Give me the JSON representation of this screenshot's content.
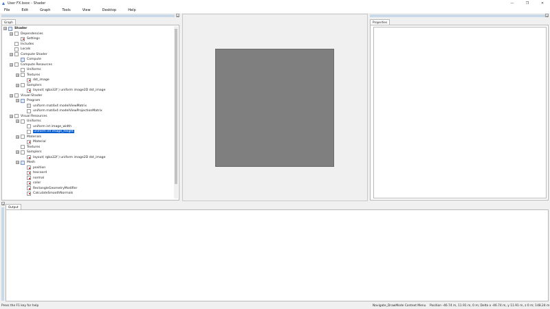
{
  "window": {
    "title": "User FX.bxoc - Shader",
    "min_glyph": "—",
    "max_glyph": "❐",
    "close_glyph": "✕"
  },
  "menu": [
    "File",
    "Edit",
    "Graph",
    "Tools",
    "View",
    "Desktop",
    "Help"
  ],
  "panels": {
    "graph_tab": "Graph",
    "properties_tab": "Properties",
    "output_tab": "Output",
    "close_glyph": "×"
  },
  "tree": [
    {
      "label": "Shader",
      "depth": 0,
      "toggle": "⊟",
      "icon": "blue",
      "bold": true
    },
    {
      "label": "Dependencies",
      "depth": 1,
      "toggle": "⊟",
      "icon": "plain"
    },
    {
      "label": "Settings",
      "depth": 2,
      "toggle": "",
      "icon": "red"
    },
    {
      "label": "Includes",
      "depth": 1,
      "toggle": "",
      "icon": "plain"
    },
    {
      "label": "Locals",
      "depth": 1,
      "toggle": "",
      "icon": "plain"
    },
    {
      "label": "Compute Shader",
      "depth": 1,
      "toggle": "⊟",
      "icon": "plain"
    },
    {
      "label": "Compute",
      "depth": 2,
      "toggle": "",
      "icon": "blue"
    },
    {
      "label": "Compute Resources",
      "depth": 1,
      "toggle": "⊟",
      "icon": "plain"
    },
    {
      "label": "Uniforms",
      "depth": 2,
      "toggle": "",
      "icon": "plain"
    },
    {
      "label": "Textures",
      "depth": 2,
      "toggle": "⊟",
      "icon": "plain"
    },
    {
      "label": "dst_image",
      "depth": 3,
      "toggle": "",
      "icon": "red"
    },
    {
      "label": "Samplers",
      "depth": 2,
      "toggle": "⊟",
      "icon": "plain"
    },
    {
      "label": "layout( rgba32f ) uniform image2D dst_image",
      "depth": 3,
      "toggle": "",
      "icon": "red"
    },
    {
      "label": "Visual Shader",
      "depth": 1,
      "toggle": "⊟",
      "icon": "plain"
    },
    {
      "label": "Program",
      "depth": 2,
      "toggle": "⊟",
      "icon": "blue"
    },
    {
      "label": "uniform mat4x4 modelViewMatrix",
      "depth": 3,
      "toggle": "",
      "icon": "gray"
    },
    {
      "label": "uniform mat4x4 modelViewProjectionMatrix",
      "depth": 3,
      "toggle": "",
      "icon": "plain"
    },
    {
      "label": "Visual Resources",
      "depth": 1,
      "toggle": "⊟",
      "icon": "plain"
    },
    {
      "label": "Uniforms",
      "depth": 2,
      "toggle": "⊟",
      "icon": "plain"
    },
    {
      "label": "uniform int image_width",
      "depth": 3,
      "toggle": "",
      "icon": "plain"
    },
    {
      "label": "uniform int image_height",
      "depth": 3,
      "toggle": "",
      "icon": "plain",
      "selected": true
    },
    {
      "label": "Materials",
      "depth": 2,
      "toggle": "⊟",
      "icon": "plain"
    },
    {
      "label": "Material",
      "depth": 3,
      "toggle": "",
      "icon": "red"
    },
    {
      "label": "Textures",
      "depth": 2,
      "toggle": "",
      "icon": "plain"
    },
    {
      "label": "Samplers",
      "depth": 2,
      "toggle": "⊟",
      "icon": "plain"
    },
    {
      "label": "layout( rgba32f ) uniform image2D dst_image",
      "depth": 3,
      "toggle": "",
      "icon": "red"
    },
    {
      "label": "Mesh",
      "depth": 2,
      "toggle": "⊟",
      "icon": "blue"
    },
    {
      "label": "position",
      "depth": 3,
      "toggle": "",
      "icon": "red"
    },
    {
      "label": "texcoord",
      "depth": 3,
      "toggle": "",
      "icon": "red"
    },
    {
      "label": "normal",
      "depth": 3,
      "toggle": "",
      "icon": "red"
    },
    {
      "label": "color",
      "depth": 3,
      "toggle": "",
      "icon": "red"
    },
    {
      "label": "RectangleGeometryModifier",
      "depth": 3,
      "toggle": "",
      "icon": "red"
    },
    {
      "label": "CalculateSmoothNormals",
      "depth": 3,
      "toggle": "",
      "icon": "red"
    }
  ],
  "status": {
    "help": "Press the F1 key for help",
    "mode": "Navigate_DrawMode Context Menu",
    "position": "Position -46.74 m, 11.91 m, 0 m; Delta x -46.74 m, y 11.91 m, z 0 m; 148.24 m"
  },
  "colors": {
    "selection": "#0a5fd1",
    "render_quad": "#7f7f7f",
    "dock_title": "#c9d9e8"
  }
}
